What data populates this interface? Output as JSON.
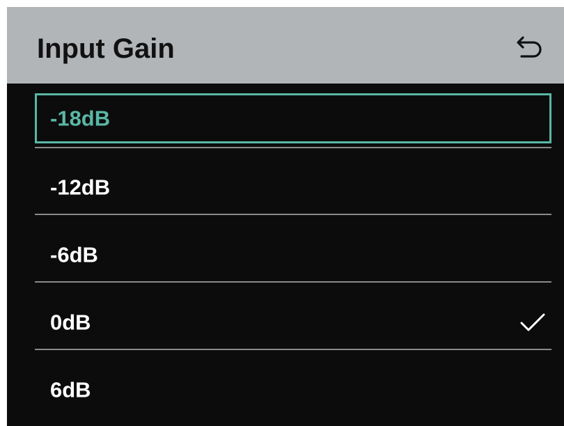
{
  "header": {
    "title": "Input Gain",
    "back_icon": "undo-arrow-icon"
  },
  "options": [
    {
      "label": "-18dB",
      "focused": true,
      "checked": false
    },
    {
      "label": "-12dB",
      "focused": false,
      "checked": false
    },
    {
      "label": "-6dB",
      "focused": false,
      "checked": false
    },
    {
      "label": "0dB",
      "focused": false,
      "checked": true
    },
    {
      "label": "6dB",
      "focused": false,
      "checked": false
    }
  ],
  "colors": {
    "header_bg": "#b2b5b8",
    "screen_bg": "#0c0c0d",
    "focus_accent": "#5ab7a5",
    "text": "#ffffff",
    "divider": "#8a8a8a"
  },
  "icons": {
    "checked": "checkmark-icon"
  }
}
